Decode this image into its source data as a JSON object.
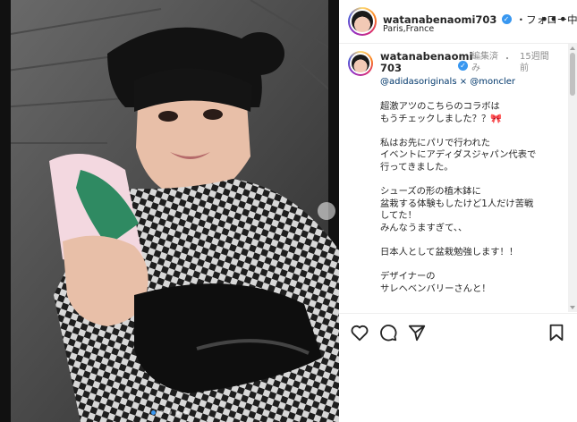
{
  "post": {
    "username": "watanabenaomi703",
    "follow_label": "フォロー中",
    "separator": "・",
    "location": "Paris,France"
  },
  "comment": {
    "username_line1": "watanabenaomi",
    "username_line2": "703",
    "edited_line1": "編集済",
    "edited_line2": "み",
    "time_sep": "・",
    "time_line1": "15週間",
    "time_line2": "前",
    "mentions": "@adidasoriginals × @moncler",
    "caption": [
      "超激アツのこちらのコラボは\nもうチェックしました？？🎀",
      "私はお先にパリで行われた\nイベントにアディダスジャパン代表で\n行ってきました。",
      "シューズの形の植木鉢に\n盆栽する体験もしたけど1人だけ苦戦\nしてた！\nみんなうますぎて、、",
      "日本人として盆栽勉強します！！",
      "デザイナーの\nサレヘベンバリーさんと！"
    ]
  },
  "icons": [
    "verified-icon",
    "more-icon",
    "heart-icon",
    "comment-icon",
    "share-icon",
    "bookmark-icon"
  ],
  "carousel": {
    "count": 5,
    "active": 0
  },
  "colors": {
    "accent": "#3897f0",
    "text": "#262626",
    "meta": "#8e8e8e",
    "mention": "#00376b"
  }
}
